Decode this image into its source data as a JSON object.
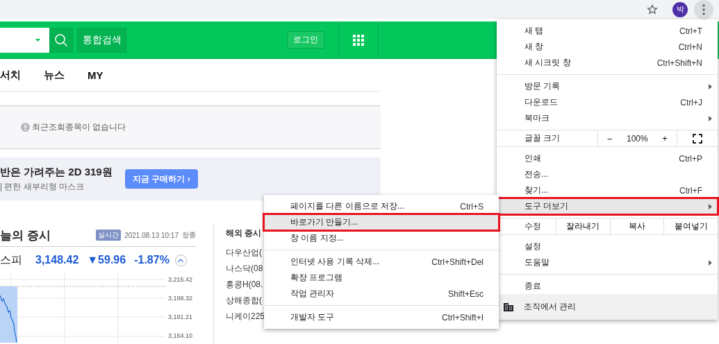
{
  "browser": {
    "avatar_letter": "박",
    "menu_button_pressed": true
  },
  "header": {
    "search_button": "통합검색",
    "login_button": "로그인"
  },
  "nav": {
    "items": [
      "서치",
      "뉴스",
      "MY"
    ]
  },
  "recent": {
    "message": "최근조회종목이 없습니다"
  },
  "banner": {
    "title": "반은 가려주는 2D 319원",
    "subtitle": "| 편한 새부리형 마스크",
    "button": "지금 구매하기 ›"
  },
  "market": {
    "title": "늘의 증시",
    "badge": "실시간",
    "datetime": "2021.08.13 10:17",
    "session": "장중",
    "index": {
      "name": "스피",
      "value": "3,148.42",
      "change": "▼59.96",
      "percent": "-1.87%"
    },
    "y_tick_labels": [
      "3,215.42",
      "3,198.32",
      "3,181.21",
      "3,164.10"
    ],
    "overseas": {
      "title": "해외 증시",
      "items": [
        "다우산업(",
        "나스닥(08",
        "홍콩H(08.",
        "상해종합(",
        "니케이225"
      ]
    }
  },
  "main_menu": {
    "items": [
      {
        "kind": "item",
        "label": "새 탭",
        "shortcut": "Ctrl+T",
        "has_submenu": false,
        "selected": false
      },
      {
        "kind": "item",
        "label": "새 창",
        "shortcut": "Ctrl+N",
        "has_submenu": false,
        "selected": false
      },
      {
        "kind": "item",
        "label": "새 시크릿 창",
        "shortcut": "Ctrl+Shift+N",
        "has_submenu": false,
        "selected": false
      },
      {
        "kind": "separator"
      },
      {
        "kind": "item",
        "label": "방문 기록",
        "has_submenu": true,
        "selected": false
      },
      {
        "kind": "item",
        "label": "다운로드",
        "shortcut": "Ctrl+J",
        "has_submenu": false,
        "selected": false
      },
      {
        "kind": "item",
        "label": "북마크",
        "has_submenu": true,
        "selected": false
      },
      {
        "kind": "separator"
      },
      {
        "kind": "zoom",
        "label": "글꼴 크기",
        "minus": "–",
        "value": "100%",
        "plus": "+"
      },
      {
        "kind": "separator"
      },
      {
        "kind": "item",
        "label": "인쇄",
        "shortcut": "Ctrl+P",
        "has_submenu": false,
        "selected": false
      },
      {
        "kind": "item",
        "label": "전송...",
        "has_submenu": false,
        "selected": false
      },
      {
        "kind": "item",
        "label": "찾기...",
        "shortcut": "Ctrl+F",
        "has_submenu": false,
        "selected": false
      },
      {
        "kind": "item",
        "label": "도구 더보기",
        "has_submenu": true,
        "selected": true
      },
      {
        "kind": "separator"
      },
      {
        "kind": "edit",
        "label": "수정",
        "buttons": [
          "잘라내기",
          "복사",
          "붙여넣기"
        ]
      },
      {
        "kind": "separator"
      },
      {
        "kind": "item",
        "label": "설정",
        "has_submenu": false,
        "selected": false
      },
      {
        "kind": "item",
        "label": "도움말",
        "has_submenu": true,
        "selected": false
      },
      {
        "kind": "separator"
      },
      {
        "kind": "item",
        "label": "종료",
        "has_submenu": false,
        "selected": false
      },
      {
        "kind": "managed",
        "label": "조직에서 관리"
      }
    ]
  },
  "sub_menu": {
    "items": [
      {
        "kind": "item",
        "label": "페이지를 다른 이름으로 저장...",
        "shortcut": "Ctrl+S",
        "selected": false
      },
      {
        "kind": "item",
        "label": "바로가기 만들기...",
        "selected": true
      },
      {
        "kind": "item",
        "label": "창 이름 지정...",
        "selected": false
      },
      {
        "kind": "separator"
      },
      {
        "kind": "item",
        "label": "인터넷 사용 기록 삭제...",
        "shortcut": "Ctrl+Shift+Del",
        "selected": false
      },
      {
        "kind": "item",
        "label": "확장 프로그램",
        "selected": false
      },
      {
        "kind": "item",
        "label": "작업 관리자",
        "shortcut": "Shift+Esc",
        "selected": false
      },
      {
        "kind": "separator"
      },
      {
        "kind": "item",
        "label": "개발자 도구",
        "shortcut": "Ctrl+Shift+I",
        "selected": false
      }
    ]
  }
}
